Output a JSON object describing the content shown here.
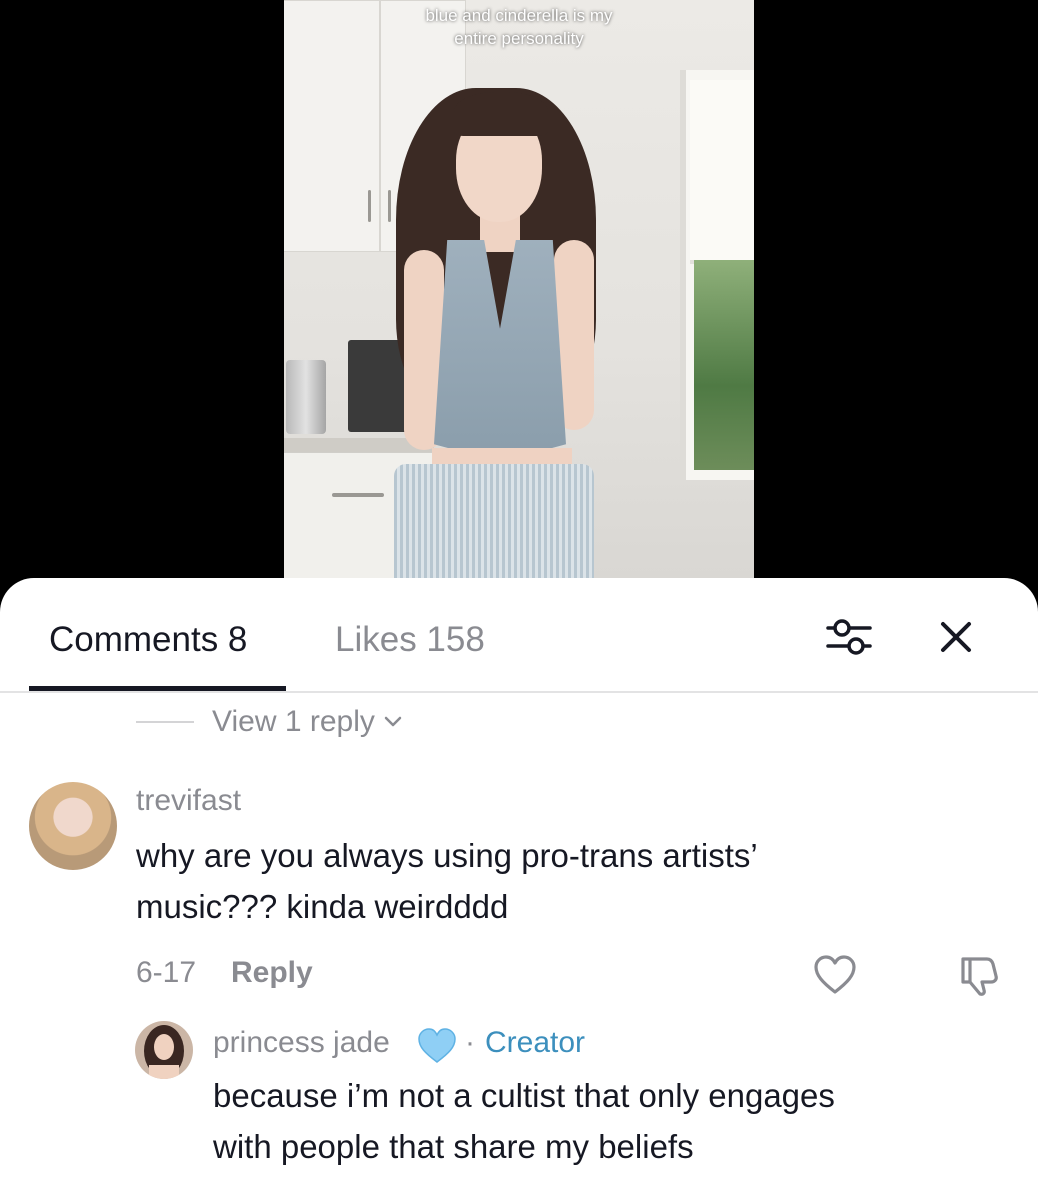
{
  "video": {
    "caption_line1": "blue and cinderella is my",
    "caption_line2": "entire personality"
  },
  "tabs": {
    "comments_label": "Comments 8",
    "likes_label": "Likes 158"
  },
  "thread": {
    "view_replies_label": "View 1 reply"
  },
  "comments": [
    {
      "username": "trevifast",
      "text_line1": "why are you always using pro-trans artists’",
      "text_line2": "music??? kinda weirdddd",
      "date": "6-17",
      "reply_label": "Reply"
    }
  ],
  "replies": [
    {
      "username": "princess jade",
      "badge_heart_color": "#8fcff5",
      "creator_label": "Creator",
      "separator": "·",
      "text_line1": "because i’m not a cultist that only engages",
      "text_line2": "with people that share my beliefs"
    }
  ],
  "colors": {
    "primary_text": "#161823",
    "secondary_text": "#8a8b91",
    "creator_accent": "#3c8fbd"
  },
  "icons": [
    "filter-sliders-icon",
    "close-icon",
    "chevron-down-icon",
    "heart-icon",
    "dislike-icon",
    "blue-heart-icon"
  ]
}
